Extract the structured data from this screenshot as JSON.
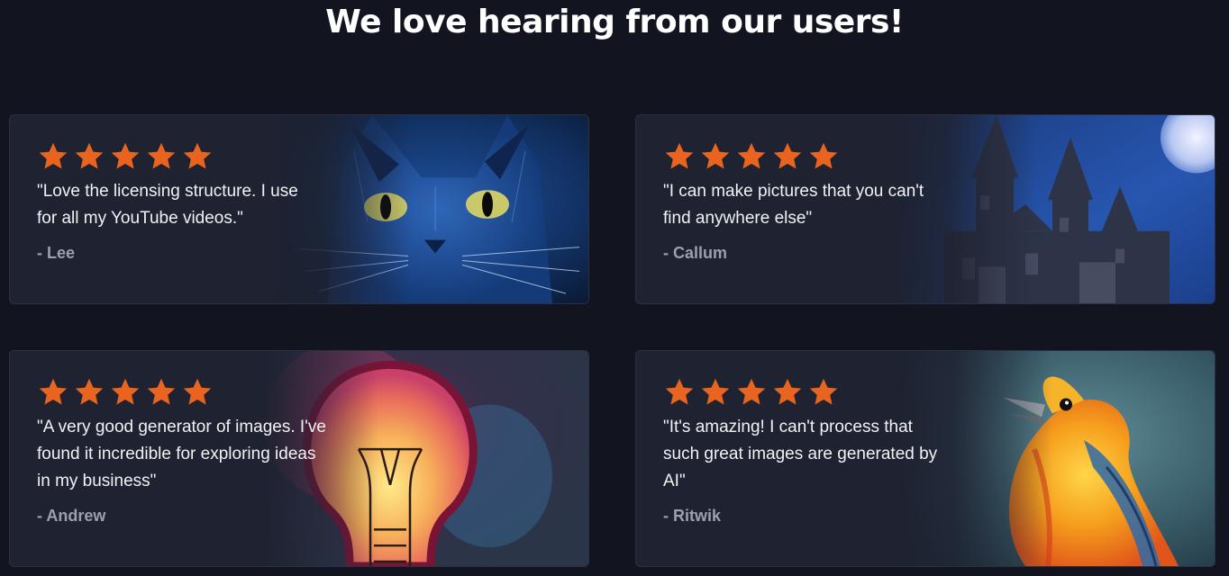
{
  "heading": "We love hearing from our users!",
  "accent_color": "#e8641f",
  "testimonials": [
    {
      "rating": 5,
      "quote": "\"Love the licensing structure. I use for all my YouTube videos.\"",
      "author": "- Lee",
      "image": "blue-cat-painting"
    },
    {
      "rating": 5,
      "quote": "\"I can make pictures that you can't find anywhere else\"",
      "author": "- Callum",
      "image": "castle-at-night-painting"
    },
    {
      "rating": 5,
      "quote": "\"A very good generator of images. I've found it incredible for exploring ideas in my business\"",
      "author": "- Andrew",
      "image": "light-bulb-watercolor"
    },
    {
      "rating": 5,
      "quote": "\"It's amazing! I can't process that such great images are generated by AI\"",
      "author": "- Ritwik",
      "image": "orange-bird-painting"
    }
  ]
}
